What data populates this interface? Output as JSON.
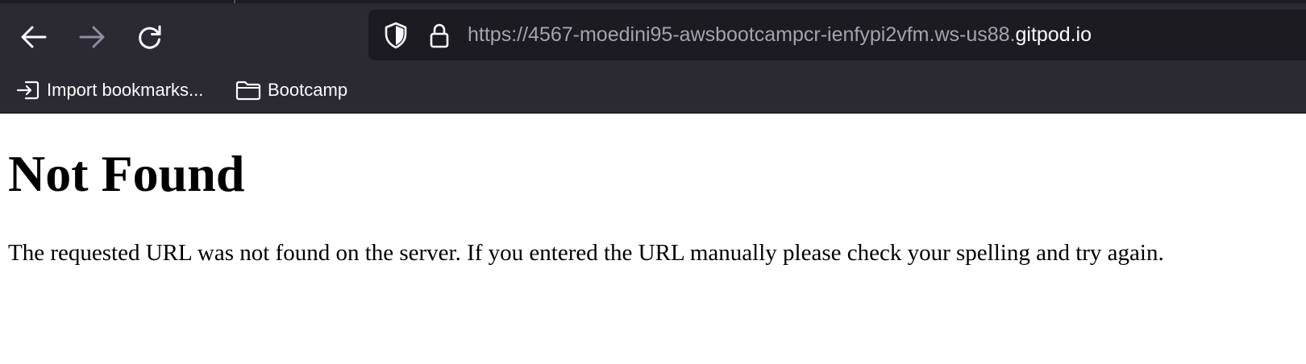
{
  "browser": {
    "toolbar": {
      "back_icon": "arrow-left-icon",
      "forward_icon": "arrow-right-icon",
      "reload_icon": "reload-icon"
    },
    "url_bar": {
      "shield_icon": "shield-icon",
      "lock_icon": "lock-icon",
      "url_prefix": "https://4567-moedini95-awsbootcampcr-ienfypi2vfm.ws-us88.",
      "url_domain": "gitpod.io"
    },
    "bookmarks": [
      {
        "label": "Import bookmarks...",
        "icon": "import-icon"
      },
      {
        "label": "Bootcamp",
        "icon": "folder-icon"
      }
    ]
  },
  "page": {
    "heading": "Not Found",
    "message": "The requested URL was not found on the server. If you entered the URL manually please check your spelling and try again."
  },
  "colors": {
    "chrome_bg": "#2b2a33",
    "url_bar_bg": "#1c1b22",
    "url_prefix": "#a3a3ad",
    "url_domain": "#fbfbfe",
    "disabled_icon": "#8f8f9d"
  }
}
